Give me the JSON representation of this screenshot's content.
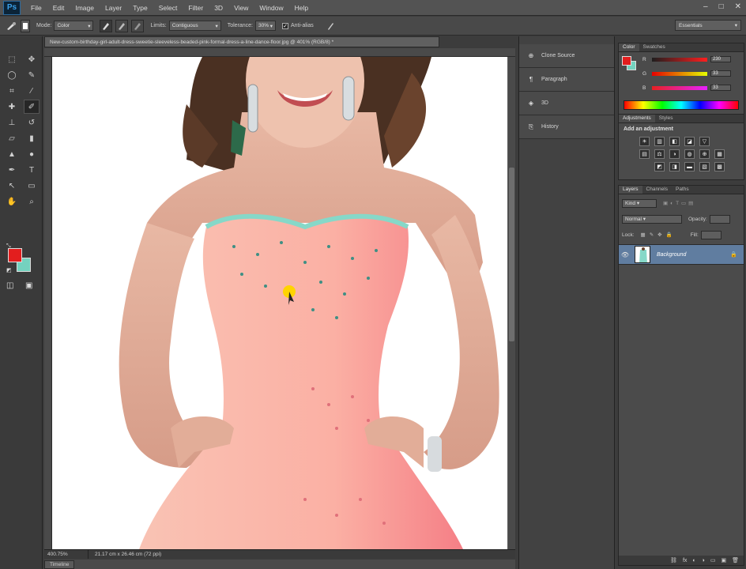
{
  "app": {
    "logo": "Ps"
  },
  "menu": [
    "File",
    "Edit",
    "Image",
    "Layer",
    "Type",
    "Select",
    "Filter",
    "3D",
    "View",
    "Window",
    "Help"
  ],
  "window_controls": [
    "–",
    "□",
    "✕"
  ],
  "options": {
    "mode_label": "Mode:",
    "mode_value": "Color",
    "limits_label": "Limits:",
    "limits_value": "Contiguous",
    "tolerance_label": "Tolerance:",
    "tolerance_value": "30%",
    "antialias_label": "Anti-alias",
    "workspace": "Essentials"
  },
  "document": {
    "tab_title": "New-custom-birthday-girl-adult-dress-sweetie-sleeveless-beaded-pink-formal-dress-a-line-dance-floor.jpg @ 401% (RGB/8) *",
    "zoom": "400.75%",
    "doc_info": "21.17 cm x 26.46 cm (72 ppi)",
    "timeline": "Timeline"
  },
  "mid_dock": [
    {
      "icon": "clone-source-icon",
      "glyph": "⊕",
      "label": "Clone Source"
    },
    {
      "icon": "paragraph-icon",
      "glyph": "¶",
      "label": "Paragraph"
    },
    {
      "icon": "3d-icon",
      "glyph": "◈",
      "label": "3D"
    },
    {
      "icon": "history-icon",
      "glyph": "⎘",
      "label": "History"
    }
  ],
  "color_panel": {
    "tabs": [
      "Color",
      "Swatches"
    ],
    "rows": [
      {
        "label": "R",
        "value": "230",
        "gradient": "linear-gradient(to right, #1e1e1e, #ff1e1e)"
      },
      {
        "label": "G",
        "value": "33",
        "gradient": "linear-gradient(to right, #e60000, #e6ff00)"
      },
      {
        "label": "B",
        "value": "33",
        "gradient": "linear-gradient(to right, #e62121, #e621ff)"
      }
    ],
    "fg": "#e31e1e",
    "bg": "#74d2bf"
  },
  "adjustments": {
    "tabs": [
      "Adjustments",
      "Styles"
    ],
    "title": "Add an adjustment",
    "icons": [
      "☀",
      "▥",
      "◧",
      "◪",
      "▽",
      "",
      "▤",
      "⚖",
      "◑",
      "◍",
      "⊕",
      "▦",
      "",
      "◩",
      "◨",
      "▬",
      "▧",
      "▩"
    ]
  },
  "layers": {
    "tabs": [
      "Layers",
      "Channels",
      "Paths"
    ],
    "kind": "Kind",
    "blend": "Normal",
    "opacity_label": "Opacity:",
    "lock_label": "Lock:",
    "fill_label": "Fill:",
    "layer_name": "Background",
    "bottom_icons": [
      "⛓",
      "fx",
      "◐",
      "◑",
      "▭",
      "▣",
      "🗑"
    ]
  }
}
